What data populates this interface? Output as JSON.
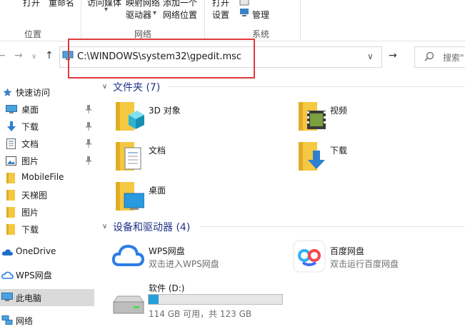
{
  "ribbon": {
    "top_items": [
      "打开",
      "重命名",
      "访问媒体",
      "映射网络",
      "添加一个",
      "打开"
    ],
    "drive_label": "驱动器",
    "netloc_label": "网络位置",
    "settings_label": "设置",
    "manage_label": "管理",
    "groups": [
      "位置",
      "网络",
      "系统"
    ]
  },
  "address": {
    "path": "C:\\WINDOWS\\system32\\gpedit.msc",
    "search_placeholder": "搜索\""
  },
  "nav": {
    "quick_access": "快速访问",
    "items": [
      {
        "label": "桌面",
        "icon": "desktop-icon",
        "pinned": true
      },
      {
        "label": "下载",
        "icon": "download-icon",
        "pinned": true
      },
      {
        "label": "文档",
        "icon": "document-icon",
        "pinned": true
      },
      {
        "label": "图片",
        "icon": "picture-icon",
        "pinned": true
      },
      {
        "label": "MobileFile",
        "icon": "folder-icon",
        "pinned": false
      },
      {
        "label": "天梯图",
        "icon": "folder-icon",
        "pinned": false
      },
      {
        "label": "图片",
        "icon": "folder-icon",
        "pinned": false
      },
      {
        "label": "下载",
        "icon": "folder-icon",
        "pinned": false
      }
    ],
    "onedrive": "OneDrive",
    "wps": "WPS网盘",
    "thispc": "此电脑",
    "network": "网络"
  },
  "folders": {
    "header": "文件夹 (7)",
    "items": [
      "3D 对象",
      "视频",
      "文档",
      "下载",
      "桌面"
    ]
  },
  "devices": {
    "header": "设备和驱动器 (4)",
    "wps": {
      "name": "WPS网盘",
      "desc": "双击进入WPS网盘"
    },
    "baidu": {
      "name": "百度网盘",
      "desc": "双击运行百度网盘"
    },
    "drive": {
      "name": "软件 (D:)",
      "space": "114 GB 可用，共 123 GB",
      "used_fraction": 0.073
    }
  },
  "colors": {
    "accent": "#26a0da",
    "highlight": "#e0393e",
    "folder": "#f4c842"
  }
}
